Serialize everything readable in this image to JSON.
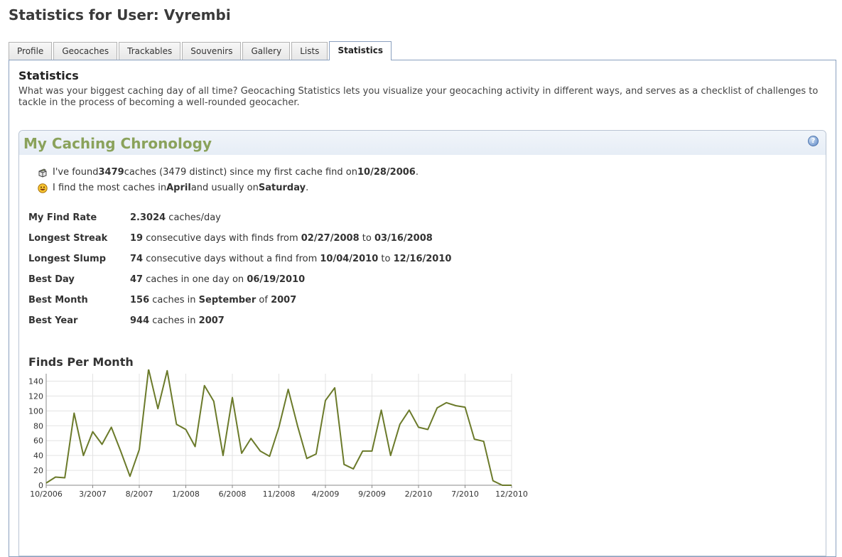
{
  "page": {
    "title": "Statistics for User: Vyrembi"
  },
  "tabs": [
    {
      "label": "Profile",
      "active": false
    },
    {
      "label": "Geocaches",
      "active": false
    },
    {
      "label": "Trackables",
      "active": false
    },
    {
      "label": "Souvenirs",
      "active": false
    },
    {
      "label": "Gallery",
      "active": false
    },
    {
      "label": "Lists",
      "active": false
    },
    {
      "label": "Statistics",
      "active": true
    }
  ],
  "statistics": {
    "heading": "Statistics",
    "intro": "What was your biggest caching day of all time? Geocaching Statistics lets you visualize your geocaching activity in different ways, and serves as a checklist of challenges to tackle in the process of becoming a well-rounded geocacher."
  },
  "chronology": {
    "title": "My Caching Chronology",
    "help_icon": "question-help-icon",
    "found_line": {
      "pre": "I've found ",
      "count": "3479",
      "mid": " caches (3479 distinct) since my first cache find on ",
      "date": "10/28/2006",
      "post": "."
    },
    "most_line": {
      "pre": "I find the most caches in ",
      "month": "April",
      "mid": " and usually on ",
      "day": "Saturday",
      "post": "."
    },
    "rows": {
      "find_rate": {
        "label": "My Find Rate",
        "v1": "2.3024",
        "t1": " caches/day"
      },
      "longest_streak": {
        "label": "Longest Streak",
        "v1": "19",
        "t1": " consecutive days with finds from ",
        "v2": "02/27/2008",
        "t2": " to ",
        "v3": "03/16/2008"
      },
      "longest_slump": {
        "label": "Longest Slump",
        "v1": "74",
        "t1": " consecutive days without a find from ",
        "v2": "10/04/2010",
        "t2": " to ",
        "v3": "12/16/2010"
      },
      "best_day": {
        "label": "Best Day",
        "v1": "47",
        "t1": " caches in one day on ",
        "v2": "06/19/2010"
      },
      "best_month": {
        "label": "Best Month",
        "v1": "156",
        "t1": " caches in ",
        "v2": "September",
        "t2": " of ",
        "v3": "2007"
      },
      "best_year": {
        "label": "Best Year",
        "v1": "944",
        "t1": " caches in ",
        "v2": "2007"
      }
    }
  },
  "finds_per_month": {
    "title": "Finds Per Month"
  },
  "chart_data": {
    "type": "line",
    "title": "Finds Per Month",
    "xlabel": "",
    "ylabel": "",
    "x": [
      "10/2006",
      "11/2006",
      "12/2006",
      "1/2007",
      "2/2007",
      "3/2007",
      "4/2007",
      "5/2007",
      "6/2007",
      "7/2007",
      "8/2007",
      "9/2007",
      "10/2007",
      "11/2007",
      "12/2007",
      "1/2008",
      "2/2008",
      "3/2008",
      "4/2008",
      "5/2008",
      "6/2008",
      "7/2008",
      "8/2008",
      "9/2008",
      "10/2008",
      "11/2008",
      "12/2008",
      "1/2009",
      "2/2009",
      "3/2009",
      "4/2009",
      "5/2009",
      "6/2009",
      "7/2009",
      "8/2009",
      "9/2009",
      "10/2009",
      "11/2009",
      "12/2009",
      "1/2010",
      "2/2010",
      "3/2010",
      "4/2010",
      "5/2010",
      "6/2010",
      "7/2010",
      "8/2010",
      "9/2010",
      "10/2010",
      "11/2010",
      "12/2010"
    ],
    "tick_labels": [
      "10/2006",
      "3/2007",
      "8/2007",
      "1/2008",
      "6/2008",
      "11/2008",
      "4/2009",
      "9/2009",
      "2/2010",
      "7/2010",
      "12/2010"
    ],
    "values": [
      3,
      11,
      10,
      97,
      40,
      72,
      55,
      78,
      46,
      12,
      48,
      156,
      103,
      154,
      82,
      75,
      52,
      134,
      113,
      40,
      118,
      43,
      63,
      46,
      39,
      78,
      129,
      80,
      36,
      42,
      114,
      131,
      28,
      22,
      46,
      46,
      101,
      40,
      82,
      101,
      78,
      75,
      104,
      111,
      107,
      105,
      62,
      59,
      6,
      0,
      0
    ],
    "ylim": [
      0,
      150
    ],
    "yticks": [
      0,
      20,
      40,
      60,
      80,
      100,
      120,
      140
    ],
    "grid": true,
    "legend": "none",
    "line_color": "#6b7a2a",
    "grid_color": "#e3e3e3"
  }
}
